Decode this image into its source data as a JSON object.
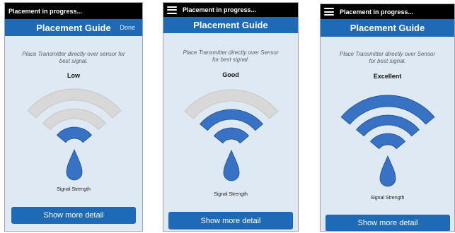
{
  "colors": {
    "nav": "#1f6ab7",
    "screen": "#dfe9f4",
    "arc_active": "#3872c4",
    "arc_inactive": "#d8d8d8",
    "drop": "#3872c4"
  },
  "screens": [
    {
      "status_text": "Placement in progress...",
      "has_menu": false,
      "title": "Placement Guide",
      "done_label": "Done",
      "instruction": "Place Transmitter directly over sensor for best signal.",
      "level": "Low",
      "signal_bars_active": 1,
      "signal_bars_total": 3,
      "signal_label": "Signal Strength",
      "button_label": "Show more detail"
    },
    {
      "status_text": "Placement in progress...",
      "has_menu": true,
      "title": "Placement Guide",
      "instruction": "Place Transmitter directly over Sensor for best signal.",
      "level": "Good",
      "signal_bars_active": 2,
      "signal_bars_total": 3,
      "signal_label": "Signal Strength",
      "button_label": "Show more detail"
    },
    {
      "status_text": "Placement in progress...",
      "has_menu": true,
      "title": "Placement Guide",
      "instruction": "Place Transmitter directly over Sensor for best signal.",
      "level": "Excellent",
      "signal_bars_active": 3,
      "signal_bars_total": 3,
      "signal_label": "Signal Strength",
      "button_label": "Show more detail"
    }
  ]
}
